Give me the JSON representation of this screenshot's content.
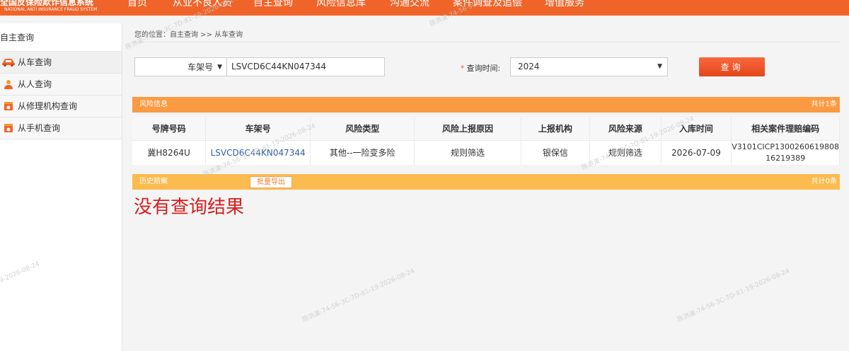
{
  "header": {
    "logo_cn": "全国反保险欺诈信息系统",
    "logo_en": "NATIONAL ANTI INSURANCE FRAUD SYSTEM",
    "nav": [
      "首页",
      "从业不良人员",
      "自主查询",
      "风险信息库",
      "沟通交流",
      "案件调查及追偿",
      "增值服务"
    ]
  },
  "sidebar": {
    "title": "自主查询",
    "items": [
      {
        "label": "从车查询",
        "icon": "car-icon"
      },
      {
        "label": "从人查询",
        "icon": "person-icon"
      },
      {
        "label": "从修理机构查询",
        "icon": "repair-shop-icon"
      },
      {
        "label": "从手机查询",
        "icon": "phone-icon"
      }
    ]
  },
  "breadcrumb": "您的位置：自主查询 >> 从车查询",
  "search": {
    "type_value": "车架号",
    "vin_value": "LSVCD6C44KN047344",
    "time_label": "查询时间:",
    "time_required_mark": "*",
    "time_value": "2024",
    "query_button": "查询"
  },
  "risk_section": {
    "title": "风险信息",
    "count": "共计1条",
    "columns": [
      "号牌号码",
      "车架号",
      "风险类型",
      "风险上报原因",
      "上报机构",
      "风险来源",
      "入库时间",
      "相关案件理赔编码"
    ],
    "rows": [
      [
        "冀H8264U",
        "LSVCD6C44KN047344",
        "其他--一险变多险",
        "规则筛选",
        "银保信",
        "规则筛选",
        "2026-07-09",
        "V3101CICP1300260619808\n16219389"
      ]
    ]
  },
  "history_section": {
    "title": "历史赔案",
    "export_button": "批量导出",
    "count": "共计0条"
  },
  "no_result": "没有查询结果",
  "watermark": "陈洪波-74-56-3C-7D-81-19-2026-08-24",
  "colors": {
    "brand": "#f0642a",
    "section": "#fa9a42",
    "history": "#fbbb4e",
    "error": "#d81e1e",
    "link": "#2f5fa8"
  }
}
